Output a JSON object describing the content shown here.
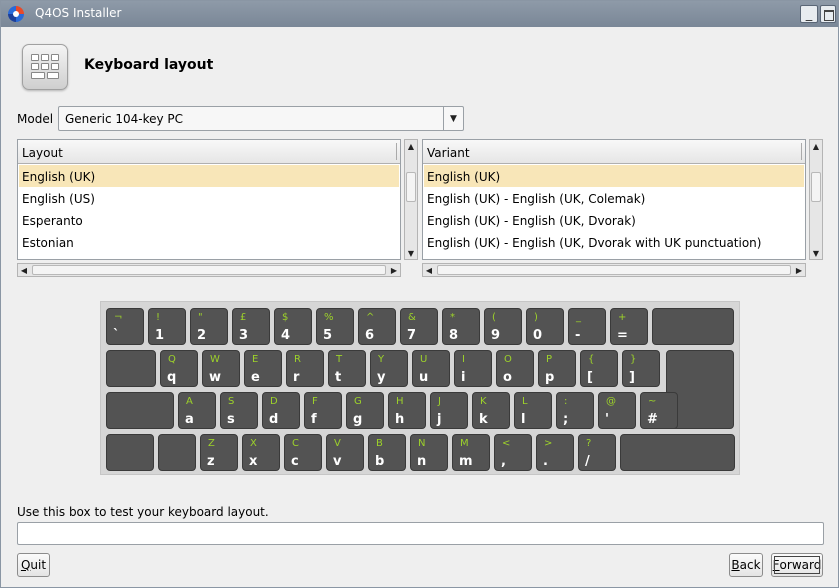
{
  "window": {
    "title": "Q4OS Installer"
  },
  "header": {
    "title": "Keyboard layout",
    "icon": "keyboard-icon"
  },
  "model": {
    "label": "Model",
    "value": "Generic 104-key PC"
  },
  "layout_list": {
    "header": "Layout",
    "items": [
      "English (UK)",
      "English (US)",
      "Esperanto",
      "Estonian"
    ],
    "selected_index": 0
  },
  "variant_list": {
    "header": "Variant",
    "items": [
      "English (UK)",
      "English (UK) - English (UK, Colemak)",
      "English (UK) - English (UK, Dvorak)",
      "English (UK) - English (UK, Dvorak with UK punctuation)"
    ],
    "selected_index": 0
  },
  "keyboard": {
    "rows": [
      [
        {
          "sh": "¬",
          "lo": "`"
        },
        {
          "sh": "!",
          "lo": "1"
        },
        {
          "sh": "\"",
          "lo": "2"
        },
        {
          "sh": "£",
          "lo": "3"
        },
        {
          "sh": "$",
          "lo": "4"
        },
        {
          "sh": "%",
          "lo": "5"
        },
        {
          "sh": "^",
          "lo": "6"
        },
        {
          "sh": "&",
          "lo": "7"
        },
        {
          "sh": "*",
          "lo": "8"
        },
        {
          "sh": "(",
          "lo": "9"
        },
        {
          "sh": ")",
          "lo": "0"
        },
        {
          "sh": "_",
          "lo": "-"
        },
        {
          "sh": "+",
          "lo": "="
        },
        {
          "sh": "",
          "lo": ""
        }
      ],
      [
        {
          "sh": "",
          "lo": ""
        },
        {
          "sh": "Q",
          "lo": "q"
        },
        {
          "sh": "W",
          "lo": "w"
        },
        {
          "sh": "E",
          "lo": "e"
        },
        {
          "sh": "R",
          "lo": "r"
        },
        {
          "sh": "T",
          "lo": "t"
        },
        {
          "sh": "Y",
          "lo": "y"
        },
        {
          "sh": "U",
          "lo": "u"
        },
        {
          "sh": "I",
          "lo": "i"
        },
        {
          "sh": "O",
          "lo": "o"
        },
        {
          "sh": "P",
          "lo": "p"
        },
        {
          "sh": "{",
          "lo": "["
        },
        {
          "sh": "}",
          "lo": "]"
        },
        {
          "sh": "",
          "lo": ""
        }
      ],
      [
        {
          "sh": "",
          "lo": ""
        },
        {
          "sh": "A",
          "lo": "a"
        },
        {
          "sh": "S",
          "lo": "s"
        },
        {
          "sh": "D",
          "lo": "d"
        },
        {
          "sh": "F",
          "lo": "f"
        },
        {
          "sh": "G",
          "lo": "g"
        },
        {
          "sh": "H",
          "lo": "h"
        },
        {
          "sh": "J",
          "lo": "j"
        },
        {
          "sh": "K",
          "lo": "k"
        },
        {
          "sh": "L",
          "lo": "l"
        },
        {
          "sh": ":",
          "lo": ";"
        },
        {
          "sh": "@",
          "lo": "'"
        },
        {
          "sh": "~",
          "lo": "#"
        }
      ],
      [
        {
          "sh": "",
          "lo": ""
        },
        {
          "sh": "",
          "lo": ""
        },
        {
          "sh": "Z",
          "lo": "z"
        },
        {
          "sh": "X",
          "lo": "x"
        },
        {
          "sh": "C",
          "lo": "c"
        },
        {
          "sh": "V",
          "lo": "v"
        },
        {
          "sh": "B",
          "lo": "b"
        },
        {
          "sh": "N",
          "lo": "n"
        },
        {
          "sh": "M",
          "lo": "m"
        },
        {
          "sh": "<",
          "lo": ","
        },
        {
          "sh": ">",
          "lo": "."
        },
        {
          "sh": "?",
          "lo": "/"
        },
        {
          "sh": "",
          "lo": ""
        }
      ]
    ]
  },
  "test": {
    "label": "Use this box to test your keyboard layout.",
    "value": ""
  },
  "buttons": {
    "quit": {
      "u": "Q",
      "rest": "uit"
    },
    "back": {
      "u": "B",
      "rest": "ack"
    },
    "forward": {
      "u": "F",
      "rest": "orward"
    }
  },
  "colors": {
    "shift_glyph": "#9dd22a",
    "key": "#535353",
    "selection": "#f8e6b8"
  }
}
